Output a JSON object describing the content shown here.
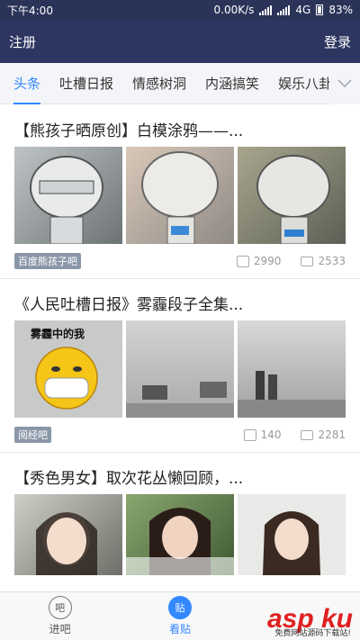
{
  "status_bar": {
    "time": "下午4:00",
    "network_speed": "0.00K/s",
    "network_type": "4G",
    "battery": "83%"
  },
  "header": {
    "left_label": "注册",
    "right_label": "登录"
  },
  "tabs": [
    "头条",
    "吐槽日报",
    "情感树洞",
    "内涵搞笑",
    "娱乐八卦"
  ],
  "posts": [
    {
      "title": "【熊孩子晒原创】白模涂鸦——...",
      "source": "百度熊孩子吧",
      "likes": "2990",
      "comments": "2533"
    },
    {
      "title": "《人民吐槽日报》雾霾段子全集...",
      "source": "阅经吧",
      "likes": "140",
      "comments": "2281",
      "image_caption": "雾霾中的我"
    },
    {
      "title": "【秀色男女】取次花丛懒回顾，..."
    }
  ],
  "bottom_nav": [
    {
      "icon_text": "吧",
      "label": "进吧"
    },
    {
      "icon_text": "贴",
      "label": "看贴"
    }
  ],
  "watermark": {
    "main": "asp ku",
    "sub": "免费网站源码下载站!"
  },
  "colors": {
    "header_bg": "#2d3660",
    "accent": "#3388ff"
  }
}
